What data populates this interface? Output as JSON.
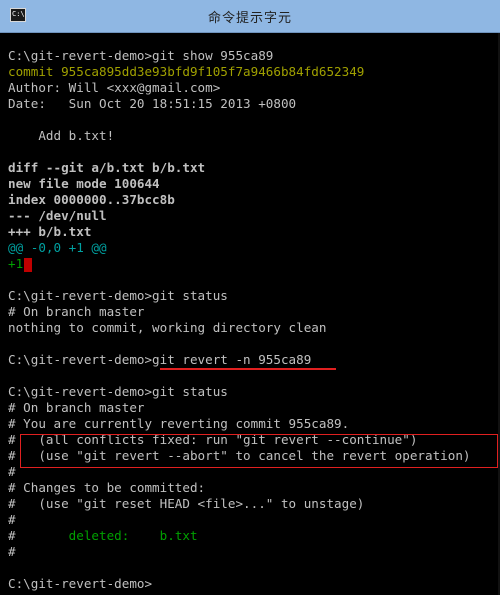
{
  "window": {
    "title": "命令提示字元",
    "icon": "cmd-icon"
  },
  "console": {
    "lines": [
      {
        "text": "C:\\git-revert-demo>git show 955ca89",
        "style": "normal"
      },
      {
        "text": "commit 955ca895dd3e93bfd9f105f7a9466b84fd652349",
        "style": "yellow"
      },
      {
        "text": "Author: Will <xxx@gmail.com>",
        "style": "normal"
      },
      {
        "text": "Date:   Sun Oct 20 18:51:15 2013 +0800",
        "style": "normal"
      },
      {
        "text": "",
        "style": "normal"
      },
      {
        "text": "    Add b.txt!",
        "style": "normal"
      },
      {
        "text": "",
        "style": "normal"
      },
      {
        "text": "diff --git a/b.txt b/b.txt",
        "style": "bold"
      },
      {
        "text": "new file mode 100644",
        "style": "bold"
      },
      {
        "text": "index 0000000..37bcc8b",
        "style": "bold"
      },
      {
        "text": "--- /dev/null",
        "style": "bold"
      },
      {
        "text": "+++ b/b.txt",
        "style": "bold"
      },
      {
        "text": "@@ -0,0 +1 @@",
        "style": "teal"
      },
      {
        "text": "+1",
        "style": "green",
        "cursor": true
      },
      {
        "text": "",
        "style": "normal"
      },
      {
        "text": "C:\\git-revert-demo>git status",
        "style": "normal"
      },
      {
        "text": "# On branch master",
        "style": "normal"
      },
      {
        "text": "nothing to commit, working directory clean",
        "style": "normal"
      },
      {
        "text": "",
        "style": "normal"
      },
      {
        "text": "C:\\git-revert-demo>git revert -n 955ca89",
        "style": "normal"
      },
      {
        "text": "",
        "style": "normal"
      },
      {
        "text": "C:\\git-revert-demo>git status",
        "style": "normal"
      },
      {
        "text": "# On branch master",
        "style": "normal"
      },
      {
        "text": "# You are currently reverting commit 955ca89.",
        "style": "normal"
      },
      {
        "text": "#   (all conflicts fixed: run \"git revert --continue\")",
        "style": "normal"
      },
      {
        "text": "#   (use \"git revert --abort\" to cancel the revert operation)",
        "style": "normal"
      },
      {
        "text": "#",
        "style": "normal"
      },
      {
        "text": "# Changes to be committed:",
        "style": "normal"
      },
      {
        "text": "#   (use \"git reset HEAD <file>...\" to unstage)",
        "style": "normal"
      },
      {
        "text": "#",
        "style": "normal"
      },
      {
        "text": "#       deleted:    b.txt",
        "style": "deleted"
      },
      {
        "text": "#",
        "style": "normal"
      },
      {
        "text": "",
        "style": "normal"
      },
      {
        "text": "C:\\git-revert-demo>",
        "style": "normal"
      }
    ]
  },
  "colors": {
    "background": "#000000",
    "text": "#c0c0c0",
    "commit_hash": "#a0a000",
    "hunk_header": "#00a0a0",
    "added_line": "#00a000",
    "cursor": "#c00000",
    "annotation": "#e02020",
    "titlebar": "#8fb7e3"
  }
}
